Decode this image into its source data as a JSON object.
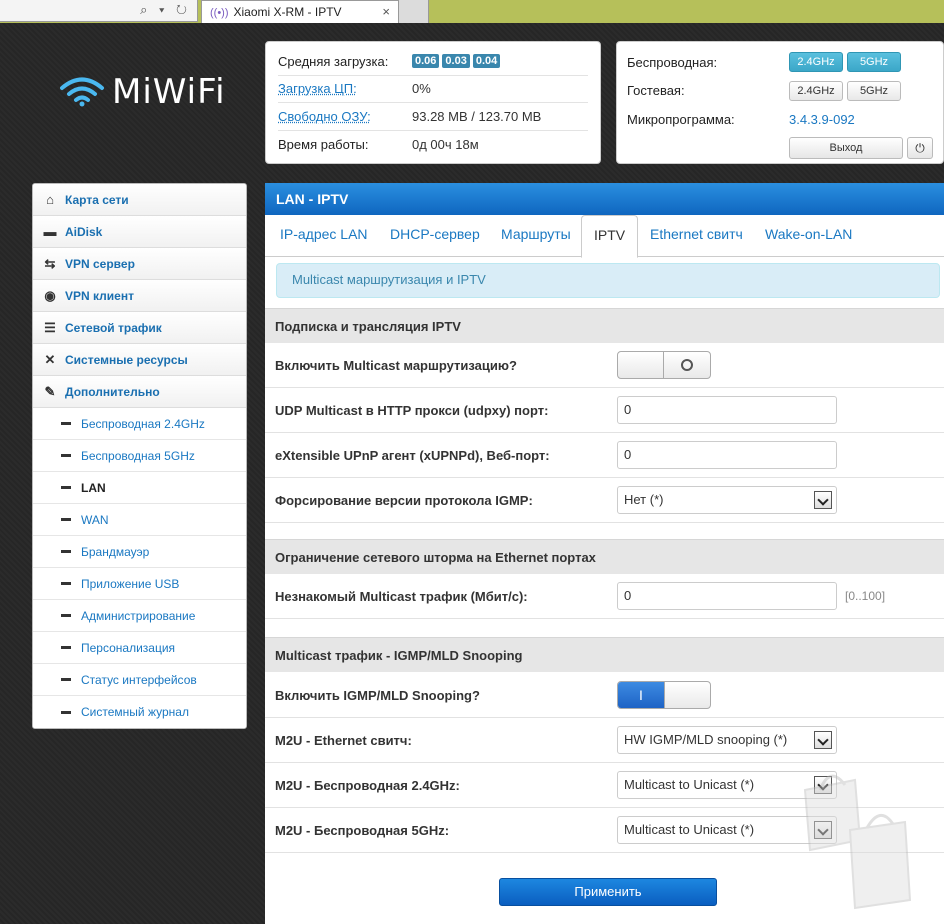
{
  "browser": {
    "tab_title": "Xiaomi X-RM - IPTV",
    "tab_close": "×",
    "address_icons": "⌕ ▾ ↻"
  },
  "logo": {
    "text": "MiWiFi"
  },
  "status": {
    "load_label": "Средняя загрузка:",
    "load_values": [
      "0.06",
      "0.03",
      "0.04"
    ],
    "cpu_label": "Загрузка ЦП:",
    "cpu_value": "0%",
    "ram_label": "Свободно ОЗУ:",
    "ram_value": "93.28 MB / 123.70 MB",
    "uptime_label": "Время работы:",
    "uptime_value": "0д 00ч 18м"
  },
  "wireless": {
    "wireless_label": "Беспроводная:",
    "guest_label": "Гостевая:",
    "firmware_label": "Микропрограмма:",
    "firmware_value": "3.4.3.9-092",
    "band_24": "2.4GHz",
    "band_5": "5GHz",
    "exit_label": "Выход",
    "power_icon": "⏻"
  },
  "sidebar": {
    "items": [
      {
        "label": "Карта сети",
        "icon": "⌂"
      },
      {
        "label": "AiDisk",
        "icon": "▬"
      },
      {
        "label": "VPN сервер",
        "icon": "⇆"
      },
      {
        "label": "VPN клиент",
        "icon": "◉"
      },
      {
        "label": "Сетевой трафик",
        "icon": "☰"
      },
      {
        "label": "Системные ресурсы",
        "icon": "✕"
      },
      {
        "label": "Дополнительно",
        "icon": "✎"
      }
    ],
    "subitems": [
      "Беспроводная 2.4GHz",
      "Беспроводная 5GHz",
      "LAN",
      "WAN",
      "Брандмауэр",
      "Приложение USB",
      "Администрирование",
      "Персонализация",
      "Статус интерфейсов",
      "Системный журнал"
    ]
  },
  "main": {
    "title": "LAN - IPTV",
    "tabs": [
      "IP-адрес LAN",
      "DHCP-сервер",
      "Маршруты",
      "IPTV",
      "Ethernet свитч",
      "Wake-on-LAN"
    ],
    "alert": "Multicast маршрутизация и IPTV",
    "section1": "Подписка и трансляция IPTV",
    "multicast_label": "Включить Multicast маршрутизацию?",
    "udpxy_label": "UDP Multicast в HTTP прокси (udpxy) порт:",
    "udpxy_value": "0",
    "xupnpd_label": "eXtensible UPnP агент (xUPNPd), Веб-порт:",
    "xupnpd_value": "0",
    "igmp_label": "Форсирование версии протокола IGMP:",
    "igmp_value": "Нет (*)",
    "section2": "Ограничение сетевого шторма на Ethernet портах",
    "storm_label": "Незнакомый Multicast трафик (Мбит/с):",
    "storm_value": "0",
    "storm_hint": "[0..100]",
    "section3": "Multicast трафик - IGMP/MLD Snooping",
    "snooping_label": "Включить IGMP/MLD Snooping?",
    "snooping_on": "I",
    "m2u_eth_label": "M2U - Ethernet свитч:",
    "m2u_eth_value": "HW IGMP/MLD snooping (*)",
    "m2u_24_label": "M2U - Беспроводная 2.4GHz:",
    "m2u_24_value": "Multicast to Unicast (*)",
    "m2u_5_label": "M2U - Беспроводная 5GHz:",
    "m2u_5_value": "Multicast to Unicast (*)",
    "apply_label": "Применить"
  }
}
